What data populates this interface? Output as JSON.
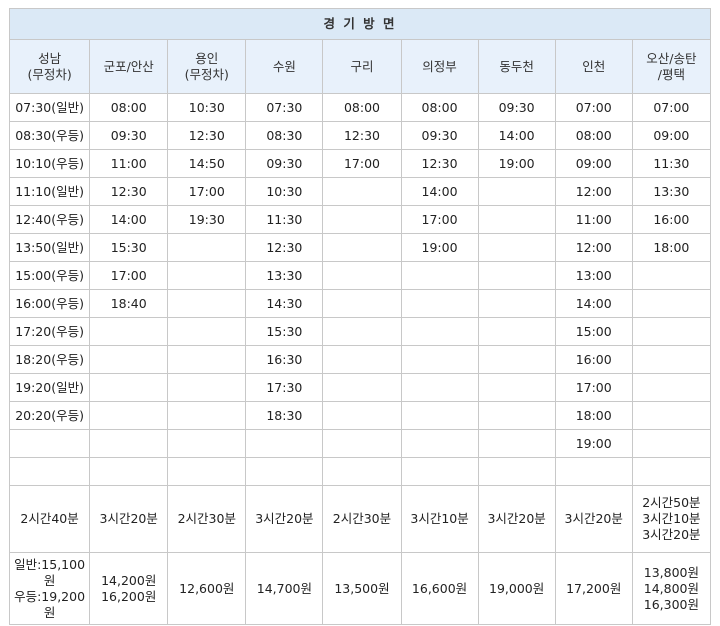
{
  "title": "경 기 방 면",
  "headers": [
    "성남\n(무정차)",
    "군포/안산",
    "용인\n(무정차)",
    "수원",
    "구리",
    "의정부",
    "동두천",
    "인천",
    "오산/송탄\n/평택"
  ],
  "rows": [
    [
      "07:30(일반)",
      "08:00",
      "10:30",
      "07:30",
      "08:00",
      "08:00",
      "09:30",
      "07:00",
      "07:00"
    ],
    [
      "08:30(우등)",
      "09:30",
      "12:30",
      "08:30",
      "12:30",
      "09:30",
      "14:00",
      "08:00",
      "09:00"
    ],
    [
      "10:10(우등)",
      "11:00",
      "14:50",
      "09:30",
      "17:00",
      "12:30",
      "19:00",
      "09:00",
      "11:30"
    ],
    [
      "11:10(일반)",
      "12:30",
      "17:00",
      "10:30",
      "",
      "14:00",
      "",
      "12:00",
      "13:30"
    ],
    [
      "12:40(우등)",
      "14:00",
      "19:30",
      "11:30",
      "",
      "17:00",
      "",
      "11:00",
      "16:00"
    ],
    [
      "13:50(일반)",
      "15:30",
      "",
      "12:30",
      "",
      "19:00",
      "",
      "12:00",
      "18:00"
    ],
    [
      "15:00(우등)",
      "17:00",
      "",
      "13:30",
      "",
      "",
      "",
      "13:00",
      ""
    ],
    [
      "16:00(우등)",
      "18:40",
      "",
      "14:30",
      "",
      "",
      "",
      "14:00",
      ""
    ],
    [
      "17:20(우등)",
      "",
      "",
      "15:30",
      "",
      "",
      "",
      "15:00",
      ""
    ],
    [
      "18:20(우등)",
      "",
      "",
      "16:30",
      "",
      "",
      "",
      "16:00",
      ""
    ],
    [
      "19:20(일반)",
      "",
      "",
      "17:30",
      "",
      "",
      "",
      "17:00",
      ""
    ],
    [
      "20:20(우등)",
      "",
      "",
      "18:30",
      "",
      "",
      "",
      "18:00",
      ""
    ],
    [
      "",
      "",
      "",
      "",
      "",
      "",
      "",
      "19:00",
      ""
    ],
    [
      "",
      "",
      "",
      "",
      "",
      "",
      "",
      "",
      ""
    ]
  ],
  "durations": [
    "2시간40분",
    "3시간20분",
    "2시간30분",
    "3시간20분",
    "2시간30분",
    "3시간10분",
    "3시간20분",
    "3시간20분",
    "2시간50분\n3시간10분\n3시간20분"
  ],
  "fares": [
    "일반:15,100원\n우등:19,200원",
    "14,200원\n16,200원",
    "12,600원",
    "14,700원",
    "13,500원",
    "16,600원",
    "19,000원",
    "17,200원",
    "13,800원\n14,800원\n16,300원"
  ]
}
